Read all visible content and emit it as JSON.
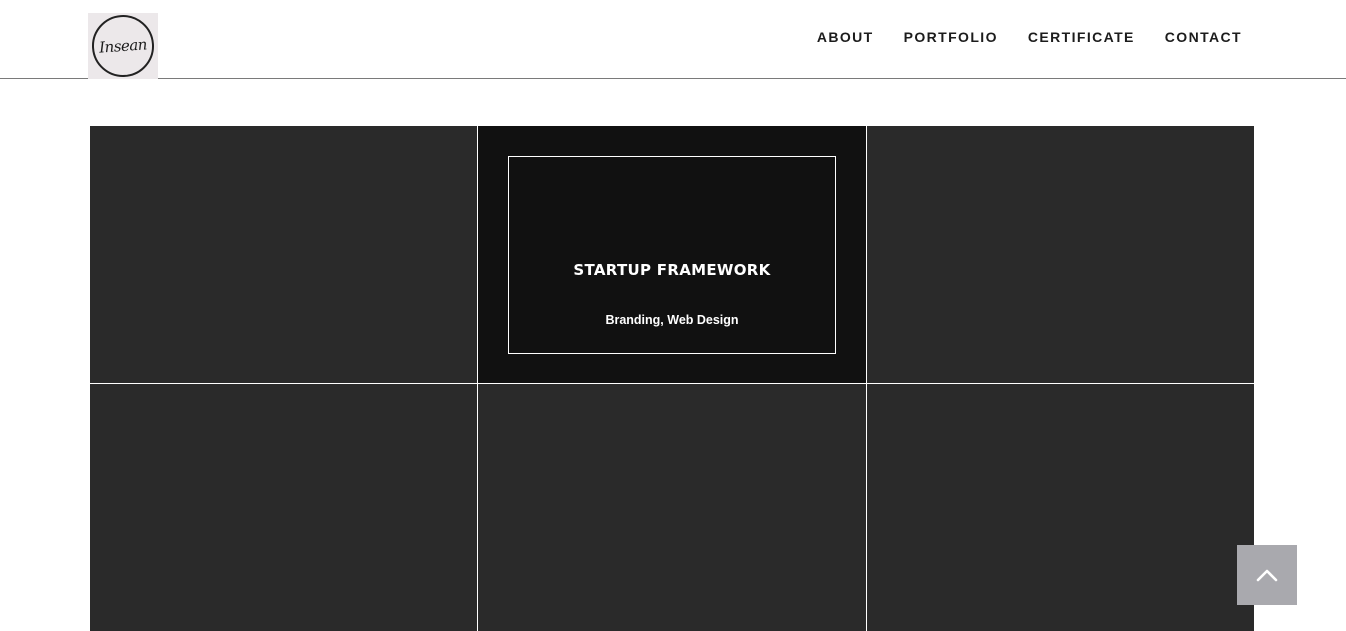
{
  "header": {
    "logo_text": "Insean",
    "nav": [
      {
        "label": "ABOUT"
      },
      {
        "label": "PORTFOLIO"
      },
      {
        "label": "CERTIFICATE"
      },
      {
        "label": "CONTACT"
      }
    ]
  },
  "portfolio": {
    "items": [
      {},
      {
        "title": "STARTUP FRAMEWORK",
        "categories": "Branding, Web Design"
      },
      {},
      {},
      {},
      {}
    ]
  },
  "colors": {
    "tile": "#2a2a2a",
    "tile_hover": "#111111",
    "scroll_top_button": "#a9a9ae"
  },
  "icons": {
    "scroll_top": "chevron-up-icon"
  }
}
